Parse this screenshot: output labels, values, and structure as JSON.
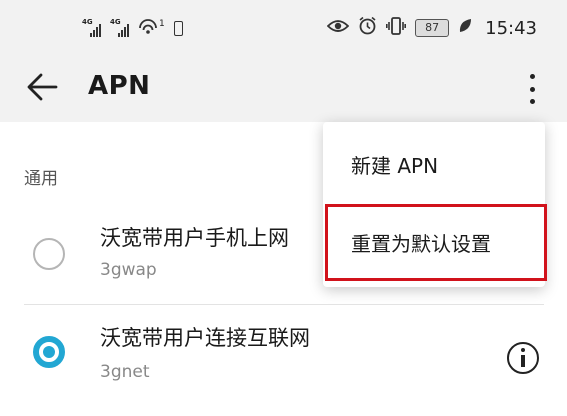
{
  "status_bar": {
    "sim1_label": "4G",
    "sim2_label": "4G",
    "hotspot_badge": "1",
    "battery_level": "87",
    "time": "15:43",
    "icons": [
      "signal-icon",
      "signal-icon",
      "hotspot-icon",
      "small-battery-icon",
      "eye-icon",
      "alarm-icon",
      "vibrate-icon",
      "battery-icon",
      "leaf-icon"
    ]
  },
  "app_bar": {
    "title": "APN",
    "back_icon": "arrow-left-icon",
    "more_icon": "more-vertical-icon"
  },
  "list": {
    "section_header": "通用",
    "items": [
      {
        "name": "沃宽带用户手机上网",
        "apn": "3gwap",
        "selected": false
      },
      {
        "name": "沃宽带用户连接互联网",
        "apn": "3gnet",
        "selected": true
      }
    ]
  },
  "menu": {
    "items": [
      {
        "label": "新建 APN"
      },
      {
        "label": "重置为默认设置",
        "highlighted": true
      }
    ]
  },
  "colors": {
    "accent": "#22a7d3",
    "highlight_border": "#d1121b",
    "background": "#f2f2f2"
  }
}
